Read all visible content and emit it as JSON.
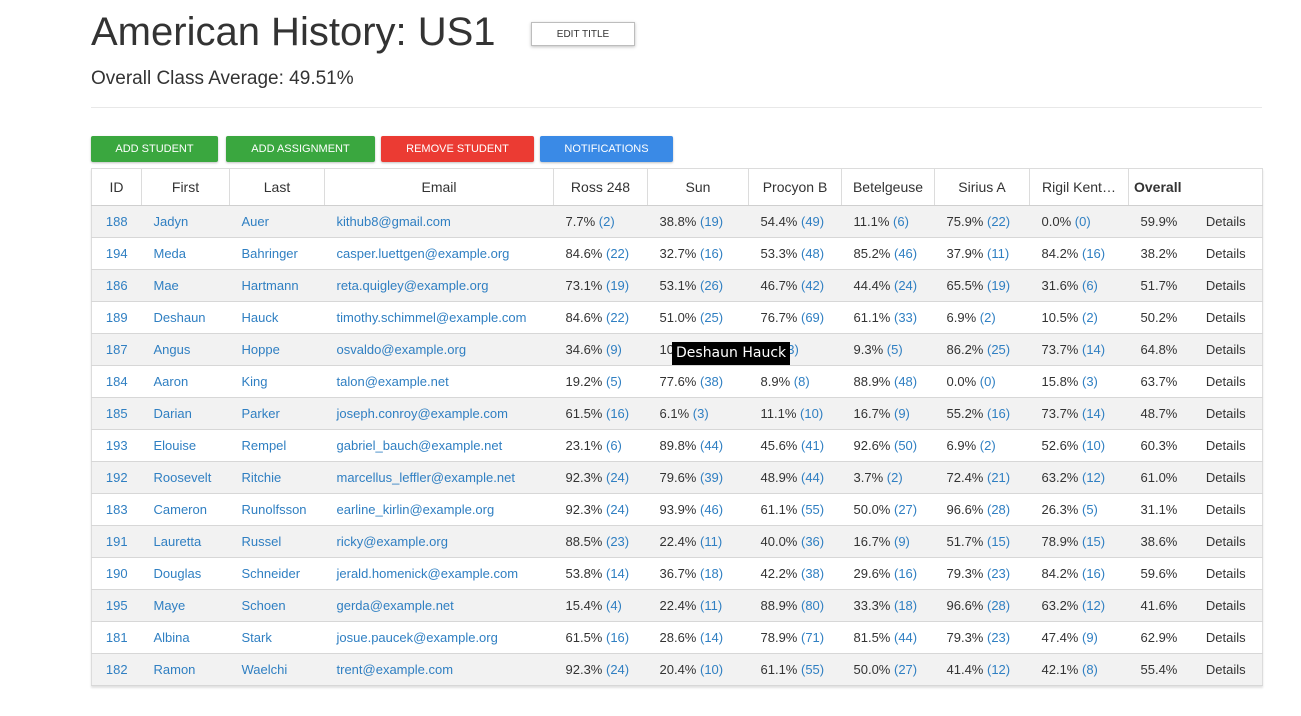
{
  "header": {
    "title": "American History: US1",
    "edit_title_label": "EDIT TITLE",
    "class_average": "Overall Class Average: 49.51%"
  },
  "toolbar": {
    "add_student": "ADD STUDENT",
    "add_assignment": "ADD ASSIGNMENT",
    "remove_student": "REMOVE STUDENT",
    "notifications": "NOTIFICATIONS"
  },
  "colors": {
    "green": "#3aa73f",
    "red": "#eb3b33",
    "blue": "#3a8ae6",
    "link": "#2f7fc2"
  },
  "table": {
    "columns": [
      "ID",
      "First",
      "Last",
      "Email",
      "Ross 248",
      "Sun",
      "Procyon B",
      "Betelgeuse",
      "Sirius A",
      "Rigil Kent…",
      "Overall",
      ""
    ],
    "details_label": "Details",
    "rows": [
      {
        "id": "188",
        "first": "Jadyn",
        "last": "Auer",
        "email": "kithub8@gmail.com",
        "grades": [
          [
            "7.7%",
            "(2)"
          ],
          [
            "38.8%",
            "(19)"
          ],
          [
            "54.4%",
            "(49)"
          ],
          [
            "11.1%",
            "(6)"
          ],
          [
            "75.9%",
            "(22)"
          ],
          [
            "0.0%",
            "(0)"
          ]
        ],
        "overall": "59.9%"
      },
      {
        "id": "194",
        "first": "Meda",
        "last": "Bahringer",
        "email": "casper.luettgen@example.org",
        "grades": [
          [
            "84.6%",
            "(22)"
          ],
          [
            "32.7%",
            "(16)"
          ],
          [
            "53.3%",
            "(48)"
          ],
          [
            "85.2%",
            "(46)"
          ],
          [
            "37.9%",
            "(11)"
          ],
          [
            "84.2%",
            "(16)"
          ]
        ],
        "overall": "38.2%"
      },
      {
        "id": "186",
        "first": "Mae",
        "last": "Hartmann",
        "email": "reta.quigley@example.org",
        "grades": [
          [
            "73.1%",
            "(19)"
          ],
          [
            "53.1%",
            "(26)"
          ],
          [
            "46.7%",
            "(42)"
          ],
          [
            "44.4%",
            "(24)"
          ],
          [
            "65.5%",
            "(19)"
          ],
          [
            "31.6%",
            "(6)"
          ]
        ],
        "overall": "51.7%"
      },
      {
        "id": "189",
        "first": "Deshaun",
        "last": "Hauck",
        "email": "timothy.schimmel@example.com",
        "grades": [
          [
            "84.6%",
            "(22)"
          ],
          [
            "51.0%",
            "(25)"
          ],
          [
            "76.7%",
            "(69)"
          ],
          [
            "61.1%",
            "(33)"
          ],
          [
            "6.9%",
            "(2)"
          ],
          [
            "10.5%",
            "(2)"
          ]
        ],
        "overall": "50.2%"
      },
      {
        "id": "187",
        "first": "Angus",
        "last": "Hoppe",
        "email": "osvaldo@example.org",
        "grades": [
          [
            "34.6%",
            "(9)"
          ],
          [
            "10",
            ""
          ],
          [
            "%",
            "(83)"
          ],
          [
            "9.3%",
            "(5)"
          ],
          [
            "86.2%",
            "(25)"
          ],
          [
            "73.7%",
            "(14)"
          ]
        ],
        "overall": "64.8%"
      },
      {
        "id": "184",
        "first": "Aaron",
        "last": "King",
        "email": "talon@example.net",
        "grades": [
          [
            "19.2%",
            "(5)"
          ],
          [
            "77.6%",
            "(38)"
          ],
          [
            "8.9%",
            "(8)"
          ],
          [
            "88.9%",
            "(48)"
          ],
          [
            "0.0%",
            "(0)"
          ],
          [
            "15.8%",
            "(3)"
          ]
        ],
        "overall": "63.7%"
      },
      {
        "id": "185",
        "first": "Darian",
        "last": "Parker",
        "email": "joseph.conroy@example.com",
        "grades": [
          [
            "61.5%",
            "(16)"
          ],
          [
            "6.1%",
            "(3)"
          ],
          [
            "11.1%",
            "(10)"
          ],
          [
            "16.7%",
            "(9)"
          ],
          [
            "55.2%",
            "(16)"
          ],
          [
            "73.7%",
            "(14)"
          ]
        ],
        "overall": "48.7%"
      },
      {
        "id": "193",
        "first": "Elouise",
        "last": "Rempel",
        "email": "gabriel_bauch@example.net",
        "grades": [
          [
            "23.1%",
            "(6)"
          ],
          [
            "89.8%",
            "(44)"
          ],
          [
            "45.6%",
            "(41)"
          ],
          [
            "92.6%",
            "(50)"
          ],
          [
            "6.9%",
            "(2)"
          ],
          [
            "52.6%",
            "(10)"
          ]
        ],
        "overall": "60.3%"
      },
      {
        "id": "192",
        "first": "Roosevelt",
        "last": "Ritchie",
        "email": "marcellus_leffler@example.net",
        "grades": [
          [
            "92.3%",
            "(24)"
          ],
          [
            "79.6%",
            "(39)"
          ],
          [
            "48.9%",
            "(44)"
          ],
          [
            "3.7%",
            "(2)"
          ],
          [
            "72.4%",
            "(21)"
          ],
          [
            "63.2%",
            "(12)"
          ]
        ],
        "overall": "61.0%"
      },
      {
        "id": "183",
        "first": "Cameron",
        "last": "Runolfsson",
        "email": "earline_kirlin@example.org",
        "grades": [
          [
            "92.3%",
            "(24)"
          ],
          [
            "93.9%",
            "(46)"
          ],
          [
            "61.1%",
            "(55)"
          ],
          [
            "50.0%",
            "(27)"
          ],
          [
            "96.6%",
            "(28)"
          ],
          [
            "26.3%",
            "(5)"
          ]
        ],
        "overall": "31.1%"
      },
      {
        "id": "191",
        "first": "Lauretta",
        "last": "Russel",
        "email": "ricky@example.org",
        "grades": [
          [
            "88.5%",
            "(23)"
          ],
          [
            "22.4%",
            "(11)"
          ],
          [
            "40.0%",
            "(36)"
          ],
          [
            "16.7%",
            "(9)"
          ],
          [
            "51.7%",
            "(15)"
          ],
          [
            "78.9%",
            "(15)"
          ]
        ],
        "overall": "38.6%"
      },
      {
        "id": "190",
        "first": "Douglas",
        "last": "Schneider",
        "email": "jerald.homenick@example.com",
        "grades": [
          [
            "53.8%",
            "(14)"
          ],
          [
            "36.7%",
            "(18)"
          ],
          [
            "42.2%",
            "(38)"
          ],
          [
            "29.6%",
            "(16)"
          ],
          [
            "79.3%",
            "(23)"
          ],
          [
            "84.2%",
            "(16)"
          ]
        ],
        "overall": "59.6%"
      },
      {
        "id": "195",
        "first": "Maye",
        "last": "Schoen",
        "email": "gerda@example.net",
        "grades": [
          [
            "15.4%",
            "(4)"
          ],
          [
            "22.4%",
            "(11)"
          ],
          [
            "88.9%",
            "(80)"
          ],
          [
            "33.3%",
            "(18)"
          ],
          [
            "96.6%",
            "(28)"
          ],
          [
            "63.2%",
            "(12)"
          ]
        ],
        "overall": "41.6%"
      },
      {
        "id": "181",
        "first": "Albina",
        "last": "Stark",
        "email": "josue.paucek@example.org",
        "grades": [
          [
            "61.5%",
            "(16)"
          ],
          [
            "28.6%",
            "(14)"
          ],
          [
            "78.9%",
            "(71)"
          ],
          [
            "81.5%",
            "(44)"
          ],
          [
            "79.3%",
            "(23)"
          ],
          [
            "47.4%",
            "(9)"
          ]
        ],
        "overall": "62.9%"
      },
      {
        "id": "182",
        "first": "Ramon",
        "last": "Waelchi",
        "email": "trent@example.com",
        "grades": [
          [
            "92.3%",
            "(24)"
          ],
          [
            "20.4%",
            "(10)"
          ],
          [
            "61.1%",
            "(55)"
          ],
          [
            "50.0%",
            "(27)"
          ],
          [
            "41.4%",
            "(12)"
          ],
          [
            "42.1%",
            "(8)"
          ]
        ],
        "overall": "55.4%"
      }
    ]
  },
  "tooltip": {
    "text": "Deshaun Hauck"
  }
}
